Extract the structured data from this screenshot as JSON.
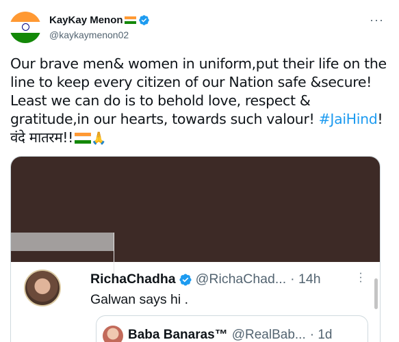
{
  "author": {
    "name": "KayKay Menon",
    "handle": "@kaykaymenon02",
    "flag_icon": "india-flag-icon",
    "verified_icon": "verified-badge-icon"
  },
  "tweet": {
    "text_main": "Our brave men& women in uniform,put their life on the line to keep every citizen of our Nation safe &secure! Least we can do is to behold love, respect & gratitude,in our hearts, towards such valour! ",
    "hashtag": "#JaiHind",
    "text_after_hashtag": "! ",
    "text_hindi": "वंदे मातरम!!",
    "pray_emoji": "🙏"
  },
  "quoted_tweet": {
    "name": "RichaChadha",
    "handle": "@RichaChad...",
    "time": "· 14h",
    "text": "Galwan says hi ."
  },
  "nested_quote": {
    "name": "Baba Banaras™",
    "handle": "@RealBab...",
    "time": "· 1d"
  },
  "colors": {
    "accent": "#1d9bf0",
    "saffron": "#ff9933",
    "green": "#138808",
    "chakra": "#000080"
  }
}
